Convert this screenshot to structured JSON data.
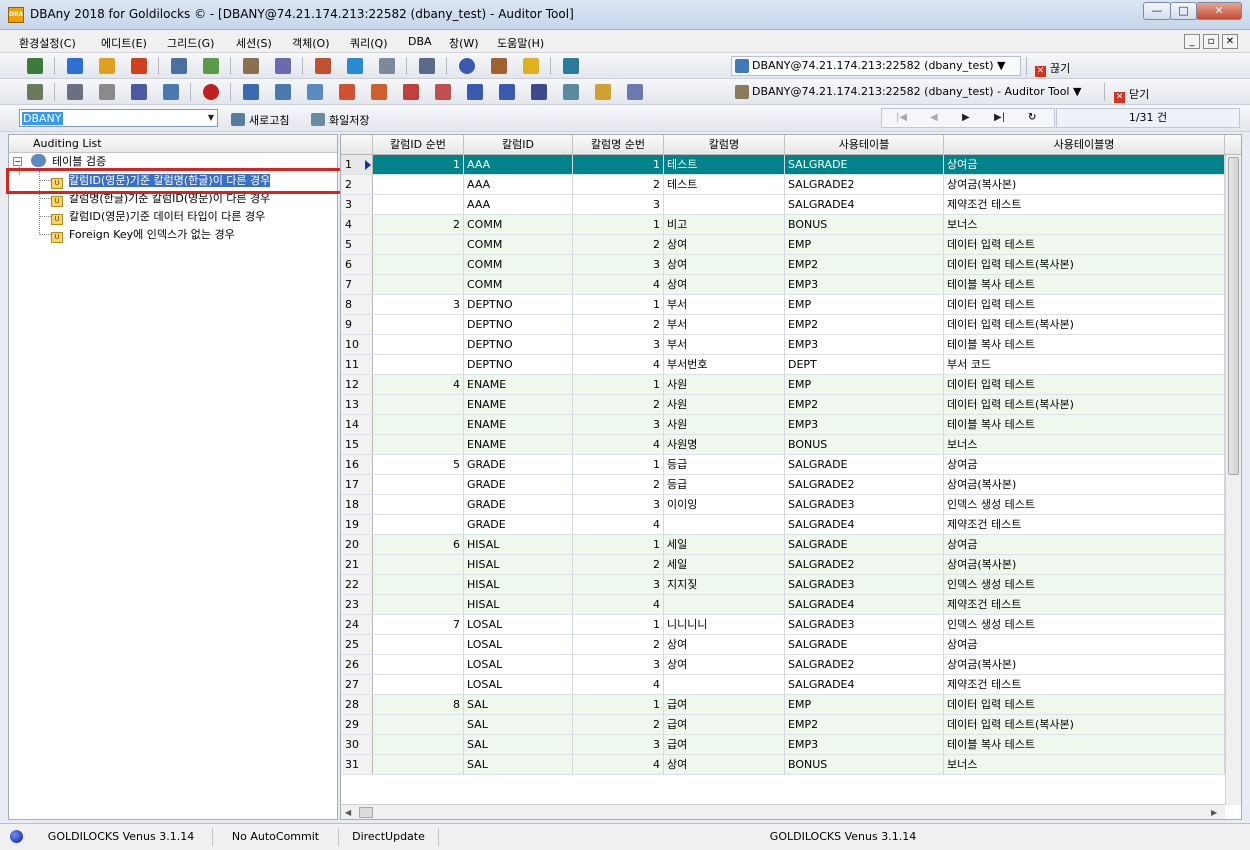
{
  "window": {
    "title": "DBAny 2018 for Goldilocks © - [DBANY@74.21.174.213:22582 (dbany_test) - Auditor Tool]",
    "app_icon_text": "DBA",
    "min": "—",
    "max": "□",
    "close": "✕"
  },
  "menu": {
    "items": [
      "환경설정(C)",
      "에디트(E)",
      "그리드(G)",
      "세션(S)",
      "객체(O)",
      "쿼리(Q)",
      "DBA",
      "창(W)",
      "도움말(H)"
    ],
    "mdi_min": "_",
    "mdi_restore": "▫",
    "mdi_close": "✕"
  },
  "toolbar1": {
    "connection": "DBANY@74.21.174.213:22582 (dbany_test) ▼",
    "disconnect_label": "끊기"
  },
  "toolbar2": {
    "connection": "DBANY@74.21.174.213:22582 (dbany_test) - Auditor Tool ▼",
    "close_label": "닫기"
  },
  "toolbar3": {
    "schema_value": "DBANY",
    "refresh_label": "새로고침",
    "save_file_label": "화일저장",
    "record_count": "1/31 건"
  },
  "left_panel": {
    "header": "Auditing List",
    "root": "테이블 검증",
    "items": [
      "칼럼ID(영문)기준 칼럼명(한글)이 다른 경우",
      "칼럼명(한글)기준 칼럼ID(영문)이 다른 경우",
      "칼럼ID(영문)기준 데이터 타입이 다른 경우",
      "Foreign Key에 인덱스가 없는 경우"
    ]
  },
  "grid": {
    "columns": [
      "칼럼ID 순번",
      "칼럼ID",
      "칼럼명 순번",
      "칼럼명",
      "사용테이블",
      "사용테이블명"
    ],
    "rows": [
      [
        "1",
        "1",
        "AAA",
        "1",
        "테스트",
        "SALGRADE",
        "상여금"
      ],
      [
        "2",
        "",
        "AAA",
        "2",
        "테스트",
        "SALGRADE2",
        "상여금(복사본)"
      ],
      [
        "3",
        "",
        "AAA",
        "3",
        "",
        "SALGRADE4",
        "제약조건 테스트"
      ],
      [
        "4",
        "2",
        "COMM",
        "1",
        "비고",
        "BONUS",
        "보너스"
      ],
      [
        "5",
        "",
        "COMM",
        "2",
        "상여",
        "EMP",
        "데이터 입력 테스트"
      ],
      [
        "6",
        "",
        "COMM",
        "3",
        "상여",
        "EMP2",
        "데이터 입력 테스트(복사본)"
      ],
      [
        "7",
        "",
        "COMM",
        "4",
        "상여",
        "EMP3",
        "테이블 복사 테스트"
      ],
      [
        "8",
        "3",
        "DEPTNO",
        "1",
        "부서",
        "EMP",
        "데이터 입력 테스트"
      ],
      [
        "9",
        "",
        "DEPTNO",
        "2",
        "부서",
        "EMP2",
        "데이터 입력 테스트(복사본)"
      ],
      [
        "10",
        "",
        "DEPTNO",
        "3",
        "부서",
        "EMP3",
        "테이블 복사 테스트"
      ],
      [
        "11",
        "",
        "DEPTNO",
        "4",
        "부서번호",
        "DEPT",
        "부서 코드"
      ],
      [
        "12",
        "4",
        "ENAME",
        "1",
        "사원",
        "EMP",
        "데이터 입력 테스트"
      ],
      [
        "13",
        "",
        "ENAME",
        "2",
        "사원",
        "EMP2",
        "데이터 입력 테스트(복사본)"
      ],
      [
        "14",
        "",
        "ENAME",
        "3",
        "사원",
        "EMP3",
        "테이블 복사 테스트"
      ],
      [
        "15",
        "",
        "ENAME",
        "4",
        "사원명",
        "BONUS",
        "보너스"
      ],
      [
        "16",
        "5",
        "GRADE",
        "1",
        "등급",
        "SALGRADE",
        "상여금"
      ],
      [
        "17",
        "",
        "GRADE",
        "2",
        "등급",
        "SALGRADE2",
        "상여금(복사본)"
      ],
      [
        "18",
        "",
        "GRADE",
        "3",
        "이이잉",
        "SALGRADE3",
        "인덱스 생성 테스트"
      ],
      [
        "19",
        "",
        "GRADE",
        "4",
        "",
        "SALGRADE4",
        "제약조건 테스트"
      ],
      [
        "20",
        "6",
        "HISAL",
        "1",
        "세일",
        "SALGRADE",
        "상여금"
      ],
      [
        "21",
        "",
        "HISAL",
        "2",
        "세일",
        "SALGRADE2",
        "상여금(복사본)"
      ],
      [
        "22",
        "",
        "HISAL",
        "3",
        "지지짖",
        "SALGRADE3",
        "인덱스 생성 테스트"
      ],
      [
        "23",
        "",
        "HISAL",
        "4",
        "",
        "SALGRADE4",
        "제약조건 테스트"
      ],
      [
        "24",
        "7",
        "LOSAL",
        "1",
        "니니니니",
        "SALGRADE3",
        "인덱스 생성 테스트"
      ],
      [
        "25",
        "",
        "LOSAL",
        "2",
        "상여",
        "SALGRADE",
        "상여금"
      ],
      [
        "26",
        "",
        "LOSAL",
        "3",
        "상여",
        "SALGRADE2",
        "상여금(복사본)"
      ],
      [
        "27",
        "",
        "LOSAL",
        "4",
        "",
        "SALGRADE4",
        "제약조건 테스트"
      ],
      [
        "28",
        "8",
        "SAL",
        "1",
        "급여",
        "EMP",
        "데이터 입력 테스트"
      ],
      [
        "29",
        "",
        "SAL",
        "2",
        "급여",
        "EMP2",
        "데이터 입력 테스트(복사본)"
      ],
      [
        "30",
        "",
        "SAL",
        "3",
        "급여",
        "EMP3",
        "테이블 복사 테스트"
      ],
      [
        "31",
        "",
        "SAL",
        "4",
        "상여",
        "BONUS",
        "보너스"
      ]
    ]
  },
  "status": {
    "version_left": "GOLDILOCKS Venus 3.1.14",
    "commit_mode": "No AutoCommit",
    "update_mode": "DirectUpdate",
    "version_right": "GOLDILOCKS Venus 3.1.14"
  },
  "colors": {
    "current_row": "#00848a",
    "alt_row": "#eef8ec",
    "selection": "#3a6fc7",
    "highlight": "#e0201a"
  }
}
